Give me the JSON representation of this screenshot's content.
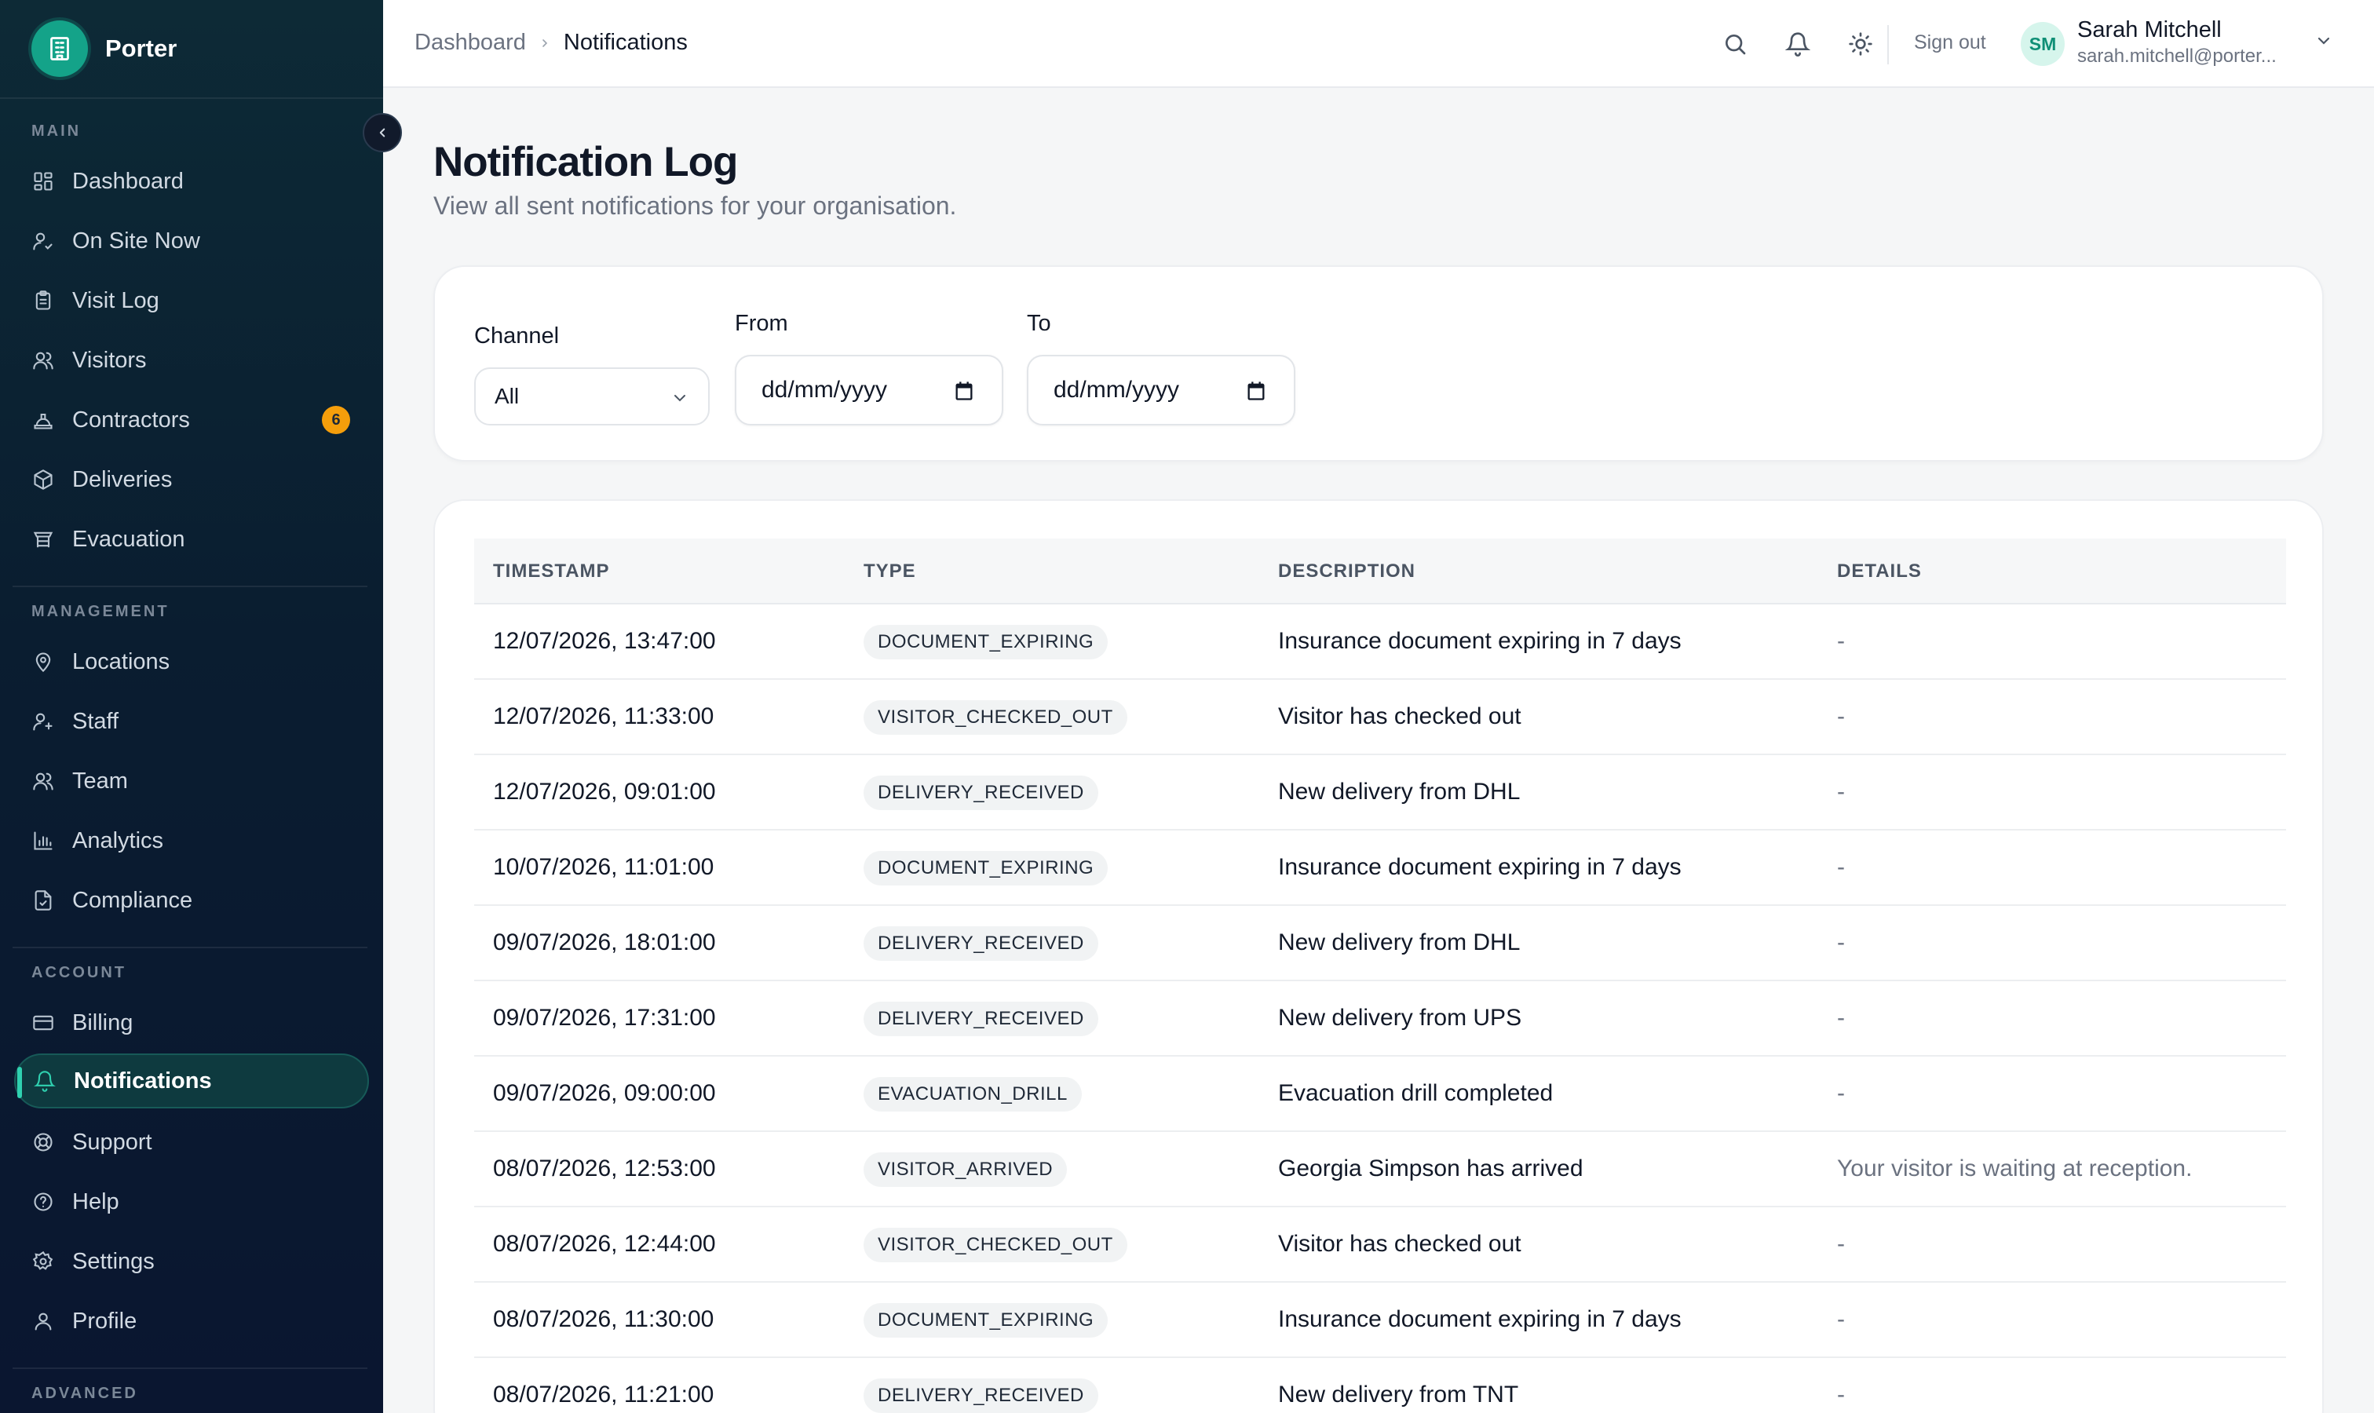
{
  "app": {
    "name": "Porter"
  },
  "sidebar": {
    "sections": [
      {
        "title": "MAIN",
        "items": [
          {
            "label": "Dashboard",
            "icon": "grid-icon"
          },
          {
            "label": "On Site Now",
            "icon": "user-check-icon"
          },
          {
            "label": "Visit Log",
            "icon": "clipboard-icon"
          },
          {
            "label": "Visitors",
            "icon": "users-icon"
          },
          {
            "label": "Contractors",
            "icon": "hard-hat-icon",
            "badge": "6"
          },
          {
            "label": "Deliveries",
            "icon": "package-icon"
          },
          {
            "label": "Evacuation",
            "icon": "evacuation-icon"
          }
        ]
      },
      {
        "title": "MANAGEMENT",
        "items": [
          {
            "label": "Locations",
            "icon": "map-pin-icon"
          },
          {
            "label": "Staff",
            "icon": "user-plus-icon"
          },
          {
            "label": "Team",
            "icon": "users-icon"
          },
          {
            "label": "Analytics",
            "icon": "bar-chart-icon"
          },
          {
            "label": "Compliance",
            "icon": "file-check-icon"
          }
        ]
      },
      {
        "title": "ACCOUNT",
        "items": [
          {
            "label": "Billing",
            "icon": "credit-card-icon"
          },
          {
            "label": "Notifications",
            "icon": "bell-icon",
            "active": true
          },
          {
            "label": "Support",
            "icon": "lifebuoy-icon"
          },
          {
            "label": "Help",
            "icon": "help-circle-icon"
          },
          {
            "label": "Settings",
            "icon": "gear-icon"
          },
          {
            "label": "Profile",
            "icon": "user-icon"
          }
        ]
      },
      {
        "title": "ADVANCED",
        "items": []
      }
    ]
  },
  "topbar": {
    "breadcrumb": [
      "Dashboard",
      "Notifications"
    ],
    "sign_out": "Sign out",
    "user": {
      "initials": "SM",
      "name": "Sarah Mitchell",
      "email": "sarah.mitchell@porter..."
    }
  },
  "page": {
    "title": "Notification Log",
    "subtitle": "View all sent notifications for your organisation."
  },
  "filters": {
    "channel_label": "Channel",
    "channel_value": "All",
    "from_label": "From",
    "from_value": "dd/mm/yyyy",
    "to_label": "To",
    "to_value": "dd/mm/yyyy"
  },
  "table": {
    "columns": [
      "TIMESTAMP",
      "TYPE",
      "DESCRIPTION",
      "DETAILS"
    ],
    "rows": [
      {
        "timestamp": "12/07/2026, 13:47:00",
        "type": "DOCUMENT_EXPIRING",
        "description": "Insurance document expiring in 7 days",
        "details": "-"
      },
      {
        "timestamp": "12/07/2026, 11:33:00",
        "type": "VISITOR_CHECKED_OUT",
        "description": "Visitor has checked out",
        "details": "-"
      },
      {
        "timestamp": "12/07/2026, 09:01:00",
        "type": "DELIVERY_RECEIVED",
        "description": "New delivery from DHL",
        "details": "-"
      },
      {
        "timestamp": "10/07/2026, 11:01:00",
        "type": "DOCUMENT_EXPIRING",
        "description": "Insurance document expiring in 7 days",
        "details": "-"
      },
      {
        "timestamp": "09/07/2026, 18:01:00",
        "type": "DELIVERY_RECEIVED",
        "description": "New delivery from DHL",
        "details": "-"
      },
      {
        "timestamp": "09/07/2026, 17:31:00",
        "type": "DELIVERY_RECEIVED",
        "description": "New delivery from UPS",
        "details": "-"
      },
      {
        "timestamp": "09/07/2026, 09:00:00",
        "type": "EVACUATION_DRILL",
        "description": "Evacuation drill completed",
        "details": "-"
      },
      {
        "timestamp": "08/07/2026, 12:53:00",
        "type": "VISITOR_ARRIVED",
        "description": "Georgia Simpson has arrived",
        "details": "Your visitor is waiting at reception."
      },
      {
        "timestamp": "08/07/2026, 12:44:00",
        "type": "VISITOR_CHECKED_OUT",
        "description": "Visitor has checked out",
        "details": "-"
      },
      {
        "timestamp": "08/07/2026, 11:30:00",
        "type": "DOCUMENT_EXPIRING",
        "description": "Insurance document expiring in 7 days",
        "details": "-"
      },
      {
        "timestamp": "08/07/2026, 11:21:00",
        "type": "DELIVERY_RECEIVED",
        "description": "New delivery from TNT",
        "details": "-"
      }
    ]
  },
  "colors": {
    "accent": "#14a389",
    "badge": "#f59e0b",
    "sidebar_bg": "#0a1d30"
  }
}
